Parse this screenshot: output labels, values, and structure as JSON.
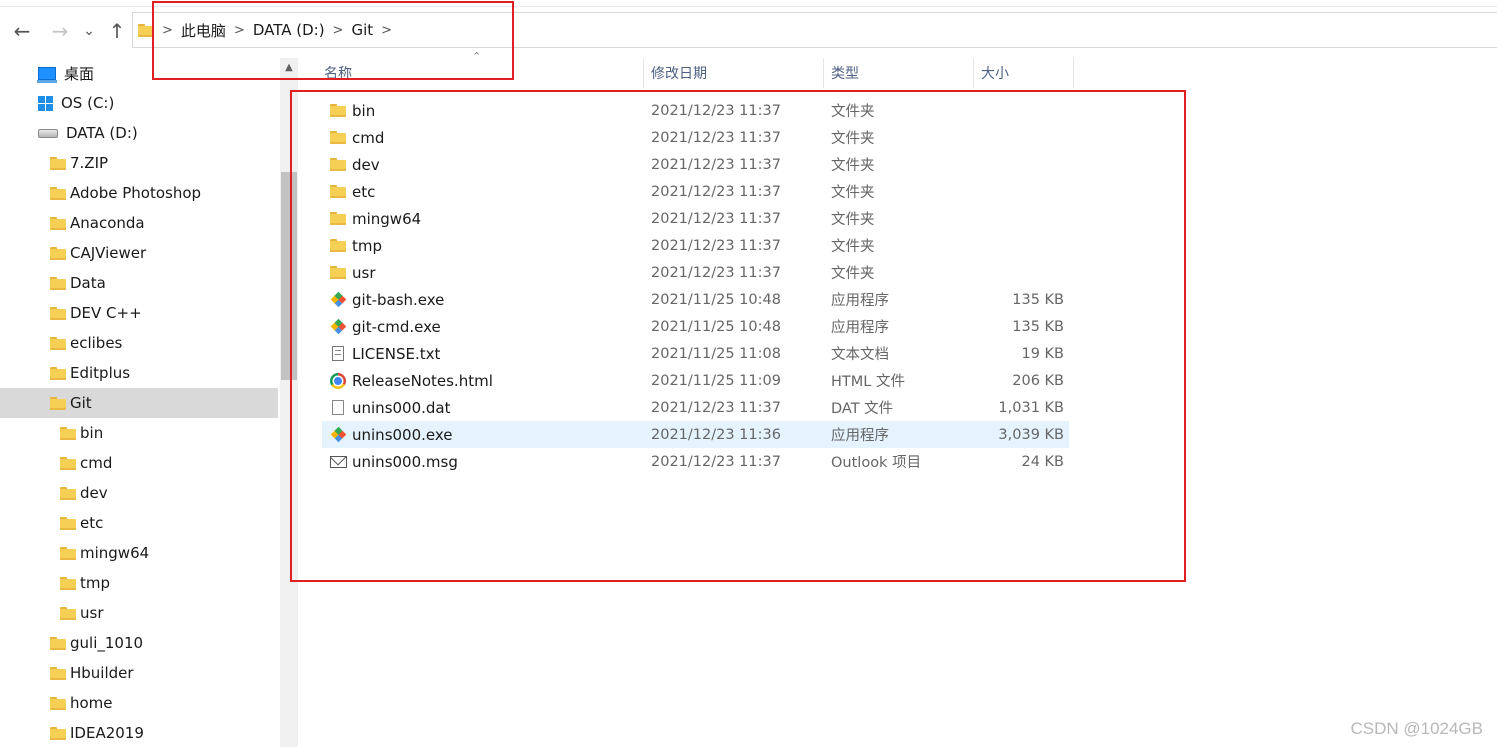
{
  "toolbar": {
    "back_glyph": "←",
    "forward_glyph": "→",
    "recent_glyph": "⌄",
    "up_glyph": "↑"
  },
  "breadcrumb": [
    "此电脑",
    "DATA (D:)",
    "Git"
  ],
  "sidebar": {
    "items": [
      {
        "label": "桌面",
        "icon": "desktop-icon"
      },
      {
        "label": "OS (C:)",
        "icon": "windows-drive-icon"
      },
      {
        "label": "DATA (D:)",
        "icon": "drive-icon"
      },
      {
        "label": "7.ZIP",
        "icon": "folder-icon"
      },
      {
        "label": "Adobe Photoshop",
        "icon": "folder-icon"
      },
      {
        "label": "Anaconda",
        "icon": "folder-icon"
      },
      {
        "label": "CAJViewer",
        "icon": "folder-icon"
      },
      {
        "label": "Data",
        "icon": "folder-icon"
      },
      {
        "label": "DEV C++",
        "icon": "folder-icon"
      },
      {
        "label": "eclibes",
        "icon": "folder-icon"
      },
      {
        "label": "Editplus",
        "icon": "folder-icon"
      },
      {
        "label": "Git",
        "icon": "folder-icon",
        "selected": true
      },
      {
        "label": "bin",
        "icon": "folder-icon"
      },
      {
        "label": "cmd",
        "icon": "folder-icon"
      },
      {
        "label": "dev",
        "icon": "folder-icon"
      },
      {
        "label": "etc",
        "icon": "folder-icon"
      },
      {
        "label": "mingw64",
        "icon": "folder-icon"
      },
      {
        "label": "tmp",
        "icon": "folder-icon"
      },
      {
        "label": "usr",
        "icon": "folder-icon"
      },
      {
        "label": "guli_1010",
        "icon": "folder-icon"
      },
      {
        "label": "Hbuilder",
        "icon": "folder-icon"
      },
      {
        "label": "home",
        "icon": "folder-icon"
      },
      {
        "label": "IDEA2019",
        "icon": "folder-icon"
      }
    ]
  },
  "columns": {
    "name": "名称",
    "modified": "修改日期",
    "type": "类型",
    "size": "大小"
  },
  "files": [
    {
      "name": "bin",
      "modified": "2021/12/23 11:37",
      "type": "文件夹",
      "size": "",
      "icon": "folder-icon"
    },
    {
      "name": "cmd",
      "modified": "2021/12/23 11:37",
      "type": "文件夹",
      "size": "",
      "icon": "folder-icon"
    },
    {
      "name": "dev",
      "modified": "2021/12/23 11:37",
      "type": "文件夹",
      "size": "",
      "icon": "folder-icon"
    },
    {
      "name": "etc",
      "modified": "2021/12/23 11:37",
      "type": "文件夹",
      "size": "",
      "icon": "folder-icon"
    },
    {
      "name": "mingw64",
      "modified": "2021/12/23 11:37",
      "type": "文件夹",
      "size": "",
      "icon": "folder-icon"
    },
    {
      "name": "tmp",
      "modified": "2021/12/23 11:37",
      "type": "文件夹",
      "size": "",
      "icon": "folder-icon"
    },
    {
      "name": "usr",
      "modified": "2021/12/23 11:37",
      "type": "文件夹",
      "size": "",
      "icon": "folder-icon"
    },
    {
      "name": "git-bash.exe",
      "modified": "2021/11/25 10:48",
      "type": "应用程序",
      "size": "135 KB",
      "icon": "git-icon"
    },
    {
      "name": "git-cmd.exe",
      "modified": "2021/11/25 10:48",
      "type": "应用程序",
      "size": "135 KB",
      "icon": "git-icon"
    },
    {
      "name": "LICENSE.txt",
      "modified": "2021/11/25 11:08",
      "type": "文本文档",
      "size": "19 KB",
      "icon": "text-document-icon"
    },
    {
      "name": "ReleaseNotes.html",
      "modified": "2021/11/25 11:09",
      "type": "HTML 文件",
      "size": "206 KB",
      "icon": "chrome-icon"
    },
    {
      "name": "unins000.dat",
      "modified": "2021/12/23 11:37",
      "type": "DAT 文件",
      "size": "1,031 KB",
      "icon": "blank-file-icon"
    },
    {
      "name": "unins000.exe",
      "modified": "2021/12/23 11:36",
      "type": "应用程序",
      "size": "3,039 KB",
      "icon": "git-icon",
      "highlighted": true
    },
    {
      "name": "unins000.msg",
      "modified": "2021/12/23 11:37",
      "type": "Outlook 项目",
      "size": "24 KB",
      "icon": "mail-icon"
    }
  ],
  "watermark": "CSDN @1024GB",
  "annotation_color": "#e02020"
}
